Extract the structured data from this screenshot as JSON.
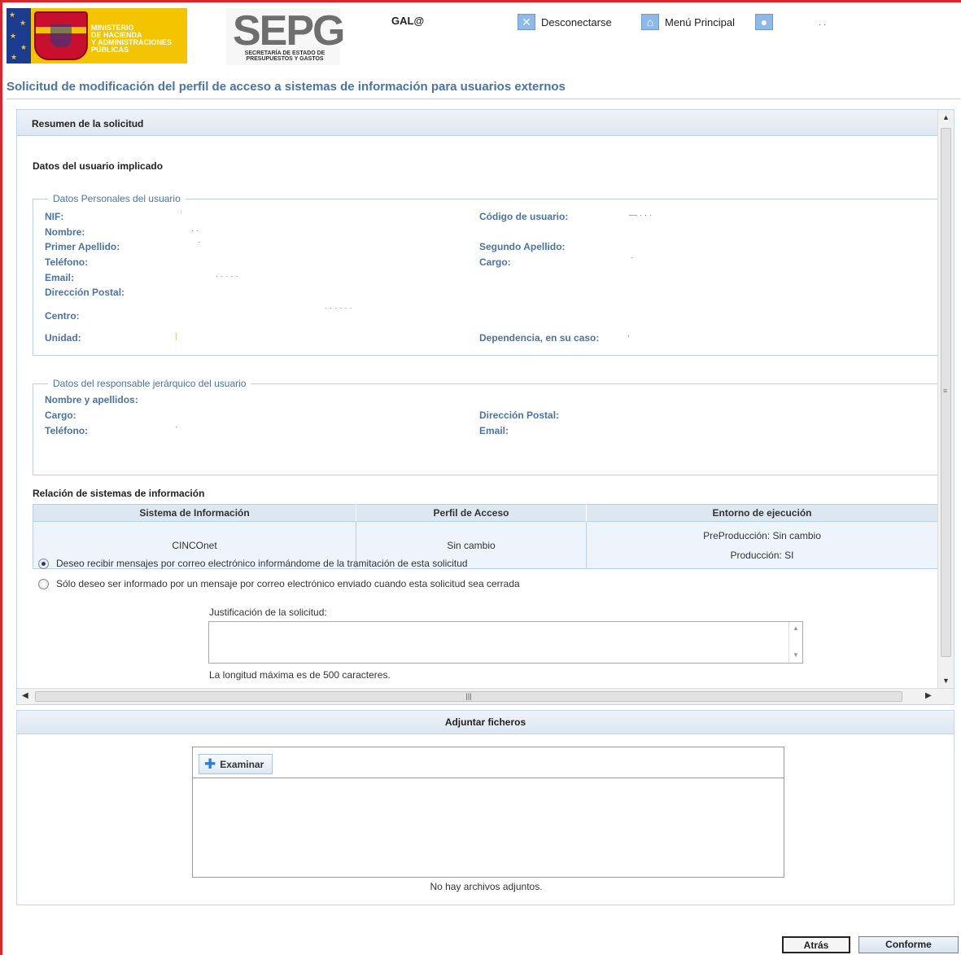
{
  "header": {
    "ministry_text": "MINISTERIO\nDE HACIENDA\nY ADMINISTRACIONES\nPÚBLICAS",
    "sepg_mark": "SEPG",
    "sepg_sub": "SECRETARÍA DE ESTADO DE PRESUPUESTOS Y GASTOS",
    "gala": "GAL@",
    "logout": "Desconectarse",
    "main_menu": "Menú Principal",
    "user_name": ". ."
  },
  "page_title": "Solicitud de modificación del perfil de acceso a sistemas de información para usuarios externos",
  "summary": {
    "heading": "Resumen de la solicitud",
    "involved_user": "Datos del usuario implicado",
    "personal": {
      "legend": "Datos Personales del usuario",
      "nif_label": "NIF:",
      "nif": "·",
      "codigo_label": "Código de usuario:",
      "codigo": "—  · · ·",
      "nombre_label": "Nombre:",
      "nombre": "· ·",
      "apellido1_label": "Primer Apellido:",
      "apellido1": "·",
      "apellido2_label": "Segundo Apellido:",
      "apellido2": "",
      "telefono_label": "Teléfono:",
      "telefono": "",
      "cargo_label": "Cargo:",
      "cargo": "·",
      "email_label": "Email:",
      "email": "· · · · ·",
      "direccion_label": "Dirección Postal:",
      "direccion": "",
      "centro_label": "Centro:",
      "centro": "·                       · · · ·          ·",
      "unidad_label": "Unidad:",
      "unidad": "|",
      "dependencia_label": "Dependencia, en su caso:",
      "dependencia": ","
    },
    "manager": {
      "legend": "Datos del responsable jerárquico del usuario",
      "nombre_label": "Nombre y apellidos:",
      "cargo_label": "Cargo:",
      "direccion_label": "Dirección Postal:",
      "telefono_label": "Teléfono:",
      "telefono": "·",
      "email_label": "Email:"
    },
    "systems_heading": "Relación de sistemas de información",
    "systems_table": {
      "headers": [
        "Sistema de Información",
        "Perfil de Acceso",
        "Entorno de ejecución"
      ],
      "rows": [
        {
          "sistema": "CINCOnet",
          "perfil": "Sin cambio",
          "entorno_1": "PreProducción: Sin cambio",
          "entorno_2": "Producción: SI"
        }
      ]
    },
    "notify_option_1": "Deseo recibir mensajes por correo electrónico informándome de la tramitación de esta solicitud",
    "notify_option_2": "Sólo deseo ser informado por un mensaje por correo electrónico enviado cuando esta solicitud sea cerrada",
    "notify_selected": 1,
    "justification_label": "Justificación de la solicitud:",
    "justification_value": "",
    "max_length_note": "La longitud máxima es de 500 caracteres."
  },
  "attachments": {
    "heading": "Adjuntar ficheros",
    "browse_button": "Examinar",
    "empty_text": "No hay archivos adjuntos."
  },
  "buttons": {
    "back": "Atrás",
    "confirm": "Conforme"
  },
  "icons": {
    "logout": "close-x-icon",
    "menu": "home-icon",
    "user": "user-icon",
    "browse": "plus-icon"
  },
  "colors": {
    "accent_blue": "#4a73a6",
    "frame_red": "#d7262c",
    "header_gradient_end": "#dde7f1"
  }
}
